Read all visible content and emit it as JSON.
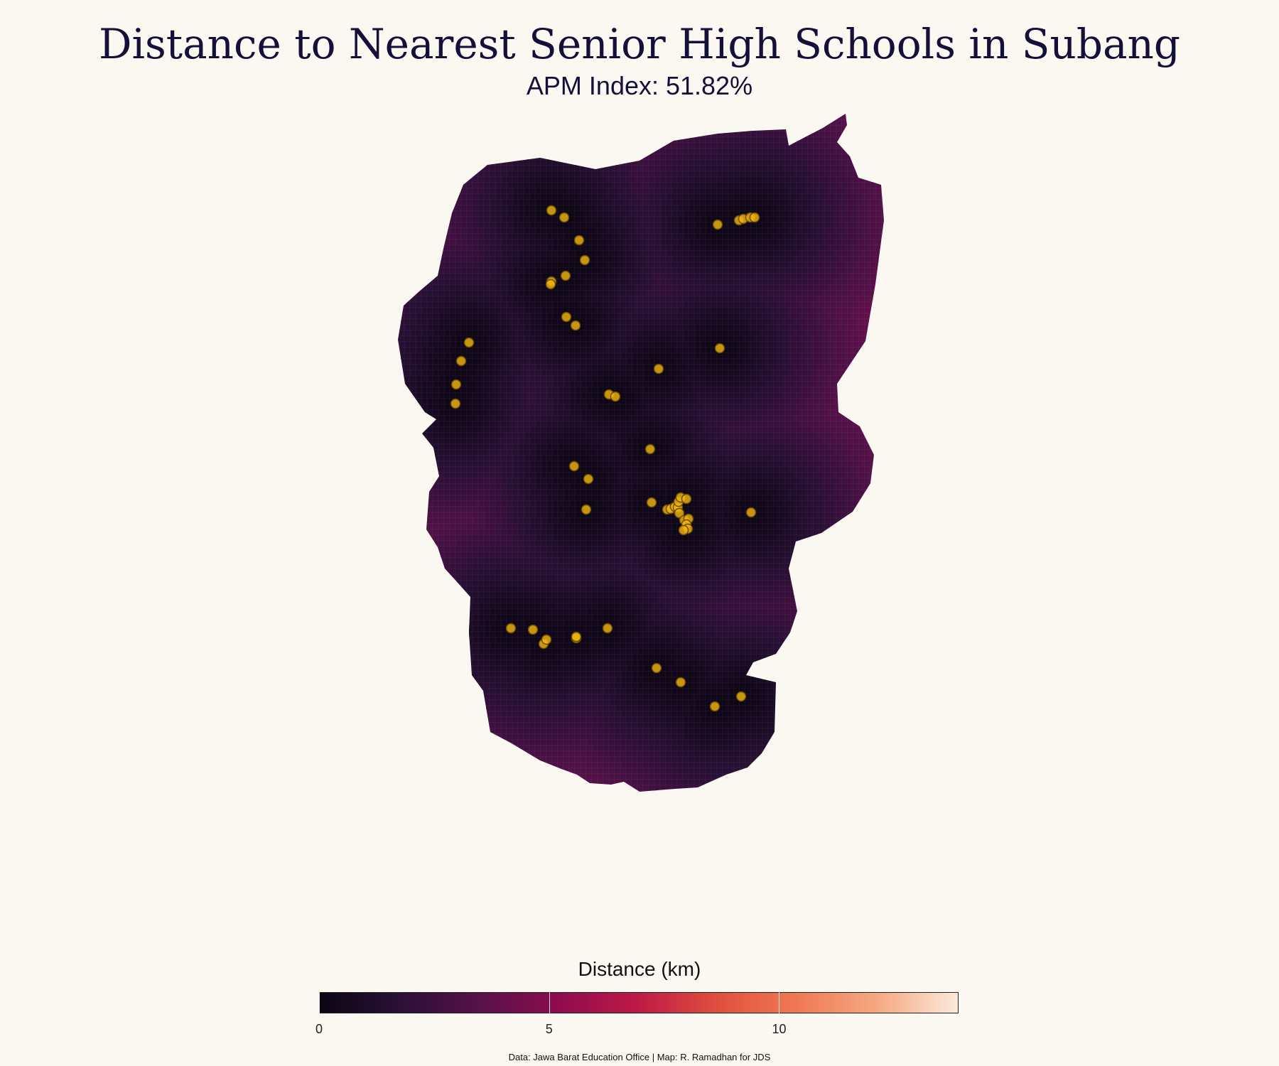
{
  "title": "Distance to Nearest Senior High Schools in Subang",
  "subtitle": "APM Index: 51.82%",
  "legend": {
    "title": "Distance (km)",
    "ticks": [
      {
        "value": 0,
        "label": "0"
      },
      {
        "value": 5,
        "label": "5"
      },
      {
        "value": 10,
        "label": "10"
      }
    ],
    "min": 0,
    "max": 13.9,
    "palette": [
      "#0b0613",
      "#2a1036",
      "#57114a",
      "#8f0c4e",
      "#bf1a46",
      "#e0503d",
      "#f07a55",
      "#f6a982",
      "#fbe9dc"
    ]
  },
  "caption": "Data: Jawa Barat Education Office | Map: R. Ramadhan for JDS",
  "map": {
    "region": "Subang",
    "marker_color": "#f2b50f",
    "marker_stroke": "#6b4a0a",
    "schools_count": 58
  }
}
